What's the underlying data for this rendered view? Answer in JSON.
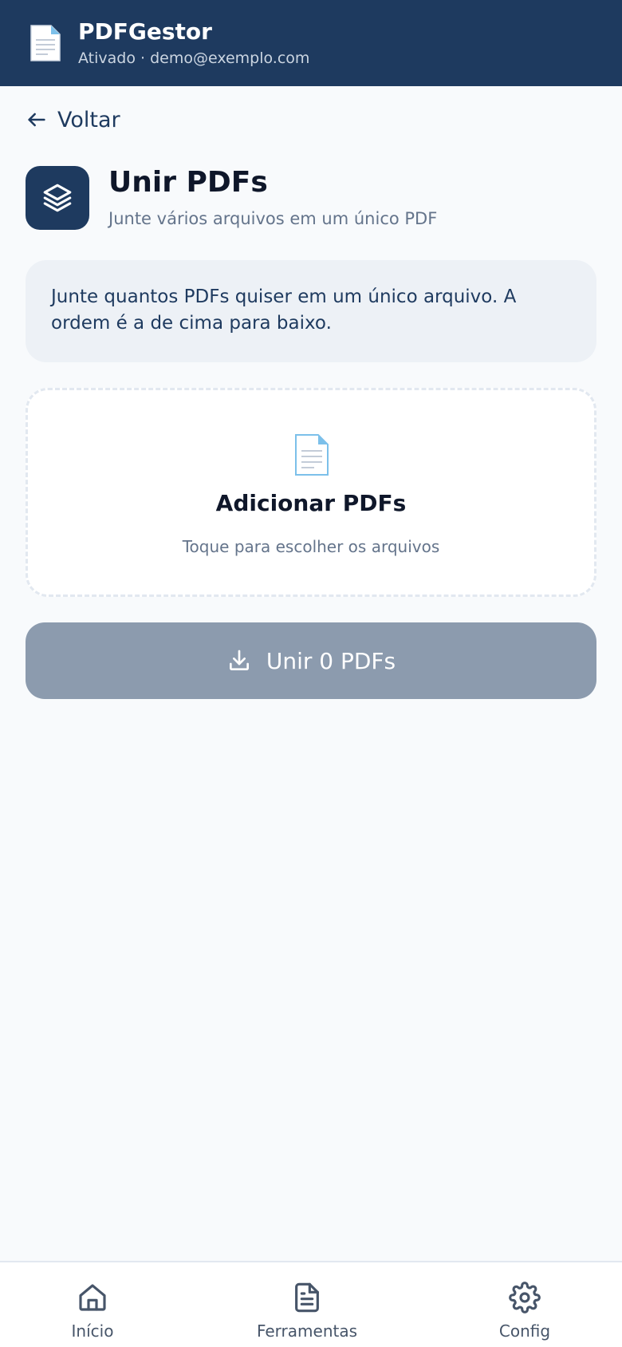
{
  "header": {
    "title": "PDFGestor",
    "subtitle": "Ativado · demo@exemplo.com",
    "logo_icon": "document-icon"
  },
  "back": {
    "label": "Voltar",
    "icon": "arrow-left-icon"
  },
  "tool": {
    "icon": "layers-icon",
    "title": "Unir PDFs",
    "description": "Junte vários arquivos em um único PDF"
  },
  "info": {
    "text": "Junte quantos PDFs quiser em um único arquivo. A ordem é a de cima para baixo."
  },
  "dropzone": {
    "icon": "document-icon",
    "title": "Adicionar PDFs",
    "hint": "Toque para escolher os arquivos"
  },
  "merge_button": {
    "icon": "download-icon",
    "label": "Unir 0 PDFs",
    "enabled": false
  },
  "bottom_nav": {
    "items": [
      {
        "label": "Início",
        "icon": "home-icon"
      },
      {
        "label": "Ferramentas",
        "icon": "file-text-icon"
      },
      {
        "label": "Config",
        "icon": "gear-icon"
      }
    ]
  },
  "colors": {
    "primary": "#1e3a5f",
    "background": "#f8fafc",
    "disabled_button": "#8c9bae",
    "muted_text": "#64748b"
  }
}
